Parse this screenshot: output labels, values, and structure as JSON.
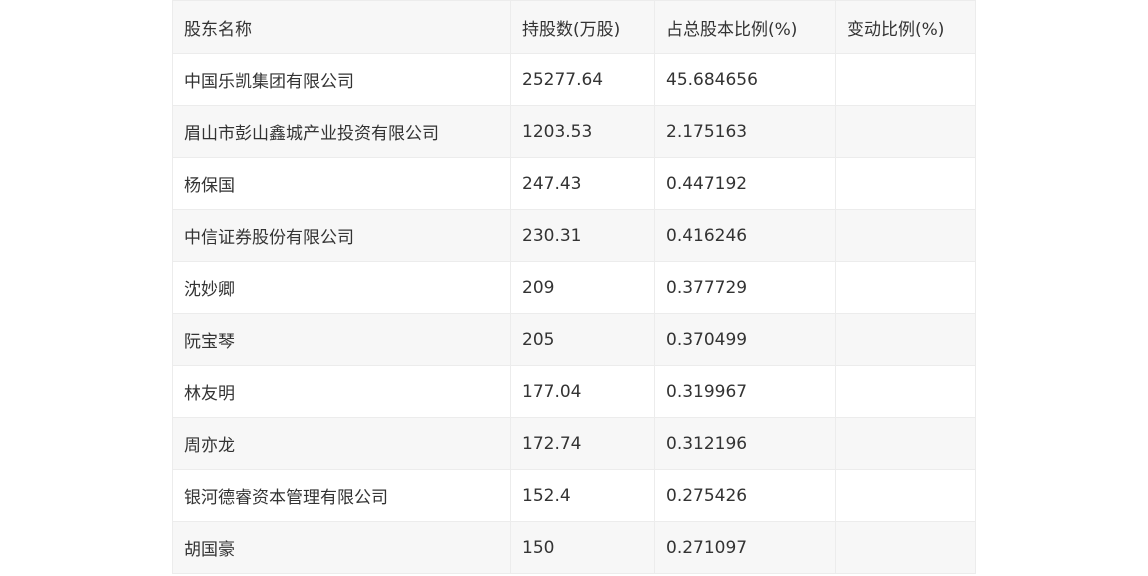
{
  "table": {
    "headers": [
      "股东名称",
      "持股数(万股)",
      "占总股本比例(%)",
      "变动比例(%)"
    ],
    "rows": [
      [
        "中国乐凯集团有限公司",
        "25277.64",
        "45.684656",
        ""
      ],
      [
        "眉山市彭山鑫城产业投资有限公司",
        "1203.53",
        "2.175163",
        ""
      ],
      [
        "杨保国",
        "247.43",
        "0.447192",
        ""
      ],
      [
        "中信证券股份有限公司",
        "230.31",
        "0.416246",
        ""
      ],
      [
        "沈妙卿",
        "209",
        "0.377729",
        ""
      ],
      [
        "阮宝琴",
        "205",
        "0.370499",
        ""
      ],
      [
        "林友明",
        "177.04",
        "0.319967",
        ""
      ],
      [
        "周亦龙",
        "172.74",
        "0.312196",
        ""
      ],
      [
        "银河德睿资本管理有限公司",
        "152.4",
        "0.275426",
        ""
      ],
      [
        "胡国豪",
        "150",
        "0.271097",
        ""
      ]
    ]
  }
}
